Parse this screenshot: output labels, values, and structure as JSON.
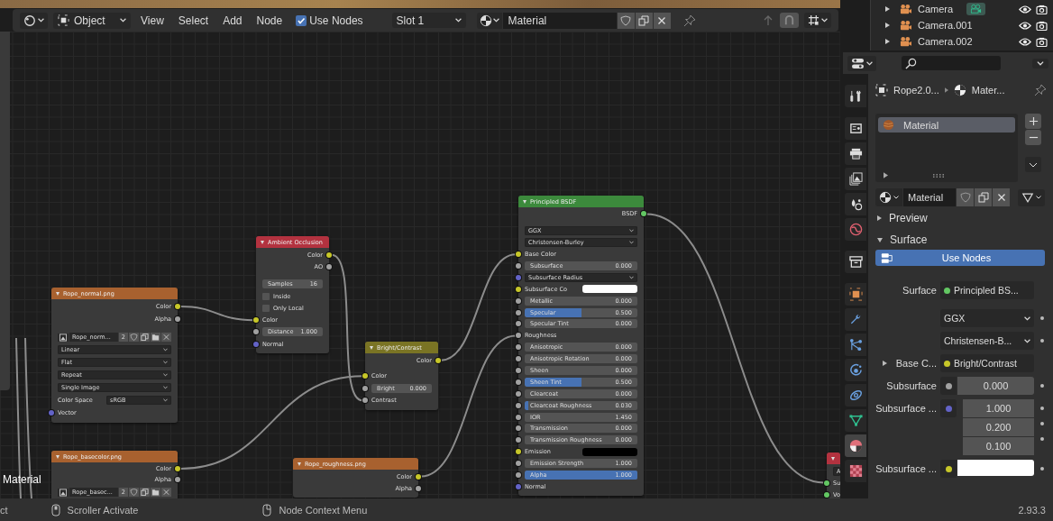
{
  "header": {
    "mode": "Object",
    "menus": [
      "View",
      "Select",
      "Add",
      "Node"
    ],
    "use_nodes": {
      "label": "Use Nodes",
      "checked": true
    },
    "slot": "Slot 1",
    "material": "Material"
  },
  "tree_name": "Material",
  "nodes": [
    {
      "title": "Rope_normal.png",
      "color": "#a8612f",
      "rows": [
        {
          "kind": "output",
          "label": "Color",
          "color": "#c7c729"
        },
        {
          "kind": "output",
          "label": "Alpha",
          "color": "#a1a1a1"
        },
        {
          "kind": "image",
          "value": "Rope_norm...",
          "users": "2"
        },
        {
          "kind": "dropdown",
          "value": "Linear"
        },
        {
          "kind": "dropdown",
          "value": "Flat"
        },
        {
          "kind": "dropdown",
          "value": "Repeat"
        },
        {
          "kind": "dropdown",
          "value": "Single Image"
        },
        {
          "kind": "labeled_dropdown",
          "label": "Color Space",
          "value": "sRGB"
        },
        {
          "kind": "input",
          "label": "Vector",
          "color": "#6363c7"
        }
      ]
    },
    {
      "title": "Ambient Occlusion",
      "color": "#b3323f",
      "rows": [
        {
          "kind": "output",
          "label": "Color",
          "color": "#c7c729"
        },
        {
          "kind": "output",
          "label": "AO",
          "color": "#a1a1a1"
        },
        {
          "kind": "number",
          "label": "Samples",
          "value": "16"
        },
        {
          "kind": "checkbox",
          "label": "Inside",
          "checked": false
        },
        {
          "kind": "checkbox",
          "label": "Only Local",
          "checked": false
        },
        {
          "kind": "input",
          "label": "Color",
          "color": "#c7c729"
        },
        {
          "kind": "number",
          "label": "Distance",
          "value": "1.000",
          "color": "#a1a1a1"
        },
        {
          "kind": "input",
          "label": "Normal",
          "color": "#6363c7"
        }
      ]
    },
    {
      "title": "Bright/Contrast",
      "color": "#7a7424",
      "rows": [
        {
          "kind": "output",
          "label": "Color",
          "color": "#c7c729"
        },
        {
          "kind": "input",
          "label": "Color",
          "color": "#c7c729"
        },
        {
          "kind": "number",
          "label": "Bright",
          "value": "0.000",
          "color": "#a1a1a1"
        },
        {
          "kind": "input",
          "label": "Contrast",
          "color": "#a1a1a1"
        }
      ]
    },
    {
      "title": "Principled BSDF",
      "color": "#3c8a3c",
      "rows": [
        {
          "kind": "output",
          "label": "BSDF",
          "color": "#63c763"
        },
        {
          "kind": "dropdown",
          "value": "GGX"
        },
        {
          "kind": "dropdown",
          "value": "Christensen-Burley"
        },
        {
          "kind": "input",
          "label": "Base Color",
          "color": "#c7c729"
        },
        {
          "kind": "number",
          "label": "Subsurface",
          "value": "0.000",
          "color": "#a1a1a1"
        },
        {
          "kind": "dropdown",
          "value": "Subsurface Radius",
          "color": "#6363c7"
        },
        {
          "kind": "color",
          "label": "Subsurface Co",
          "color": "#c7c729",
          "swatch": {
            "color": "#ffffff"
          }
        },
        {
          "kind": "number",
          "label": "Metallic",
          "value": "0.000",
          "color": "#a1a1a1"
        },
        {
          "kind": "slider",
          "label": "Specular",
          "value": "0.500",
          "color": "#a1a1a1",
          "level": 0.5
        },
        {
          "kind": "number",
          "label": "Specular Tint",
          "value": "0.000",
          "color": "#a1a1a1"
        },
        {
          "kind": "input",
          "label": "Roughness",
          "color": "#a1a1a1"
        },
        {
          "kind": "number",
          "label": "Anisotropic",
          "value": "0.000",
          "color": "#a1a1a1"
        },
        {
          "kind": "number",
          "label": "Anisotropic Rotation",
          "value": "0.000",
          "color": "#a1a1a1"
        },
        {
          "kind": "number",
          "label": "Sheen",
          "value": "0.000",
          "color": "#a1a1a1"
        },
        {
          "kind": "slider",
          "label": "Sheen Tint",
          "value": "0.500",
          "color": "#a1a1a1",
          "level": 0.5
        },
        {
          "kind": "number",
          "label": "Clearcoat",
          "value": "0.000",
          "color": "#a1a1a1"
        },
        {
          "kind": "slider",
          "label": "Clearcoat Roughness",
          "value": "0.030",
          "color": "#a1a1a1",
          "level": 0.03
        },
        {
          "kind": "number",
          "label": "IOR",
          "value": "1.450",
          "color": "#a1a1a1"
        },
        {
          "kind": "number",
          "label": "Transmission",
          "value": "0.000",
          "color": "#a1a1a1"
        },
        {
          "kind": "number",
          "label": "Transmission Roughness",
          "value": "0.000",
          "color": "#a1a1a1"
        },
        {
          "kind": "color",
          "label": "Emission",
          "color": "#c7c729",
          "swatch": {
            "color": "#000000"
          }
        },
        {
          "kind": "number",
          "label": "Emission Strength",
          "value": "1.000",
          "color": "#a1a1a1"
        },
        {
          "kind": "slider",
          "label": "Alpha",
          "value": "1.000",
          "color": "#a1a1a1",
          "level": 1
        },
        {
          "kind": "input",
          "label": "Normal",
          "color": "#6363c7"
        }
      ]
    },
    {
      "title": "Rope_basecolor.png",
      "color": "#a8612f",
      "rows": [
        {
          "kind": "output",
          "label": "Color",
          "color": "#c7c729"
        },
        {
          "kind": "output",
          "label": "Alpha",
          "color": "#a1a1a1"
        },
        {
          "kind": "image",
          "value": "Rope_basec...",
          "users": "2"
        }
      ]
    },
    {
      "title": "Rope_roughness.png",
      "color": "#a8612f",
      "rows": [
        {
          "kind": "output",
          "label": "Color",
          "color": "#c7c729"
        },
        {
          "kind": "output",
          "label": "Alpha",
          "color": "#a1a1a1"
        }
      ]
    },
    {
      "color": "#b3323f",
      "rows": [
        {
          "kind": "dropdown",
          "value": "A"
        },
        {
          "kind": "input",
          "label": "Su",
          "color": "#63c763"
        },
        {
          "kind": "input",
          "label": "Vo",
          "color": "#63c763"
        }
      ]
    }
  ],
  "status_bar": {
    "items": [
      {
        "kind": "text",
        "label": "ct"
      },
      {
        "kind": "mouse_left",
        "label": "Scroller Activate"
      },
      {
        "kind": "mouse_right",
        "label": "Node Context Menu"
      }
    ],
    "version": "2.93.3"
  },
  "outliner": {
    "rows": [
      {
        "name": "Camera",
        "data_icon": true
      },
      {
        "name": "Camera.001",
        "data_icon": false
      },
      {
        "name": "Camera.002",
        "data_icon": false
      }
    ]
  },
  "properties": {
    "tabs": [
      {
        "kind": "tool",
        "selected": false
      },
      {
        "kind": "render",
        "selected": false
      },
      {
        "kind": "output",
        "selected": false
      },
      {
        "kind": "view_layer",
        "selected": false
      },
      {
        "kind": "scene",
        "selected": false
      },
      {
        "kind": "world",
        "selected": false
      },
      {
        "kind": "collection",
        "selected": false
      },
      {
        "kind": "object",
        "selected": false
      },
      {
        "kind": "modifiers",
        "selected": false
      },
      {
        "kind": "particles",
        "selected": false
      },
      {
        "kind": "physics",
        "selected": false
      },
      {
        "kind": "constraints",
        "selected": false
      },
      {
        "kind": "data",
        "selected": false
      },
      {
        "kind": "material",
        "selected": true
      },
      {
        "kind": "texture",
        "selected": false
      }
    ],
    "breadcrumb": {
      "object": "Rope2.0...",
      "material": "Mater..."
    },
    "slots": [
      {
        "name": "Material",
        "selected": true
      }
    ],
    "material": "Material",
    "panels": [
      {
        "title": "Preview",
        "expanded": false
      },
      {
        "title": "Surface",
        "expanded": true,
        "use_nodes": {
          "label": "Use Nodes",
          "on": true
        },
        "rows": [
          {
            "kind": "link",
            "label": "Surface",
            "color": "#63c763",
            "value": "Principled BS..."
          },
          {
            "kind": "dropdown",
            "value": "GGX"
          },
          {
            "kind": "dropdown",
            "value": "Christensen-B..."
          },
          {
            "kind": "expandable_link",
            "label": "Base C...",
            "expanded": false,
            "color": "#c7c729",
            "value": "Bright/Contrast"
          },
          {
            "kind": "number",
            "label": "Subsurface",
            "color": "#a1a1a1",
            "value": "0.000"
          },
          {
            "kind": "vector",
            "label": "Subsurface ...",
            "color": "#6363c7",
            "values": [
              "1.000",
              "0.200",
              "0.100"
            ]
          },
          {
            "kind": "swatch",
            "label": "Subsurface ...",
            "color": "#c7c729",
            "swatch": {
              "color": "#ffffff"
            }
          }
        ]
      }
    ]
  }
}
